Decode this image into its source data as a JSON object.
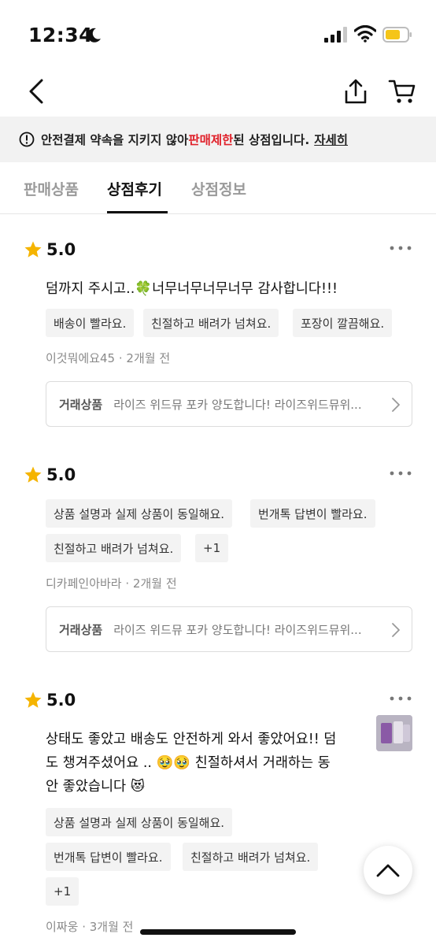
{
  "status_bar": {
    "time": "12:34"
  },
  "notice": {
    "prefix": "안전결제 약속을 지키지 않아 ",
    "highlight": "판매제한",
    "suffix": "된 상점입니다.",
    "link": "자세히"
  },
  "tabs": [
    {
      "label": "판매상품",
      "active": false
    },
    {
      "label": "상점후기",
      "active": true
    },
    {
      "label": "상점정보",
      "active": false
    }
  ],
  "reviews": [
    {
      "rating": "5.0",
      "text": "덤까지 주시고..🍀너무너무너무너무 감사합니다!!!",
      "chips": [
        "배송이 빨라요.",
        "친절하고 배려가 넘쳐요.",
        "포장이 깔끔해요."
      ],
      "author": "이것뭐에요45",
      "time": "· 2개월 전",
      "trade_label": "거래상품",
      "trade_title": "라이즈 위드뮤 포카 양도합니다! 라이즈위드뮤위..."
    },
    {
      "rating": "5.0",
      "text": "",
      "chips": [
        "상품 설명과 실제 상품이 동일해요.",
        "번개톡 답변이 빨라요.",
        "친절하고 배려가 넘쳐요.",
        "+1"
      ],
      "author": "디카페인아바라",
      "time": "· 2개월 전",
      "trade_label": "거래상품",
      "trade_title": "라이즈 위드뮤 포카 양도합니다! 라이즈위드뮤위..."
    },
    {
      "rating": "5.0",
      "text_lines": [
        "상태도 좋았고 배송도 안전하게 와서 좋았어요!! 덤",
        "도 챙겨주셨어요 .. 🥹🥹 친절하셔서 거래하는 동",
        "안 좋았습니다 😻"
      ],
      "chips": [
        "상품 설명과 실제 상품이 동일해요.",
        "번개톡 답변이 빨라요.",
        "친절하고 배려가 넘쳐요.",
        "+1"
      ],
      "author": "이짜웅",
      "time": "· 3개월 전"
    }
  ],
  "colors": {
    "accent_red": "#e0222b",
    "star": "#f5b400"
  },
  "icons": [
    "moon-icon",
    "signal-icon",
    "wifi-icon",
    "battery-icon",
    "back-arrow-icon",
    "share-icon",
    "cart-icon",
    "alert-circle-icon",
    "star-icon",
    "more-icon",
    "chevron-right-icon",
    "chevron-up-icon"
  ]
}
